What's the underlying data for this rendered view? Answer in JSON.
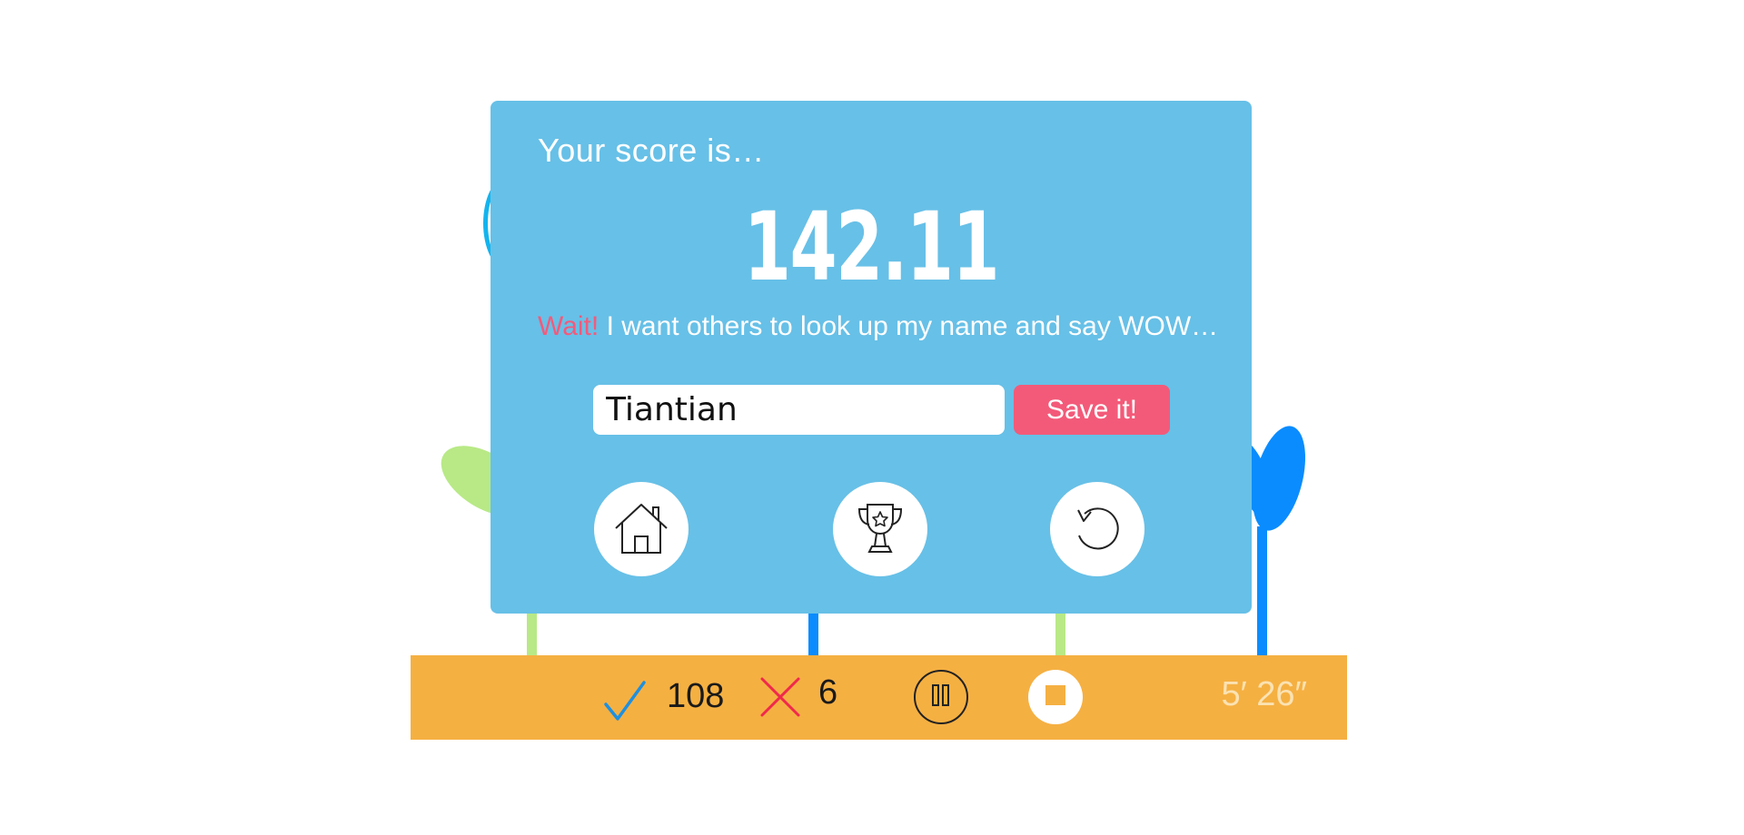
{
  "dialog": {
    "heading": "Your score is…",
    "score": "142.11",
    "prompt_highlight": "Wait!",
    "prompt_text": " I want others to look up my name and say WOW…",
    "name_value": "Tiantian",
    "save_label": "Save it!",
    "actions": [
      "home-icon",
      "trophy-icon",
      "replay-icon"
    ]
  },
  "status_bar": {
    "correct_count": "108",
    "wrong_count": "6",
    "timer": "5′ 26″",
    "controls": [
      "pause-icon",
      "stop-icon"
    ]
  },
  "colors": {
    "dialog_bg": "#67c0e7",
    "accent_pink": "#f35a79",
    "status_bar_bg": "#f5b042",
    "check_blue": "#1e90e0",
    "cross_red": "#f0294c",
    "plant_green": "#b8e986",
    "plant_blue": "#0a8cff"
  }
}
